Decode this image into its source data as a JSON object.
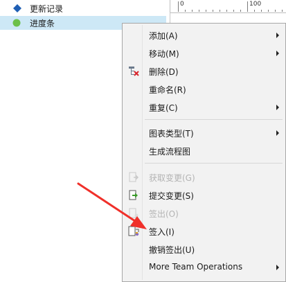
{
  "tree": {
    "items": [
      {
        "label": "更新记录",
        "icon": "diamond-node-icon",
        "color": "#1f5fb4"
      },
      {
        "label": "进度条",
        "icon": "green-dot-node-icon",
        "color": "#6cc04a",
        "selected": true
      }
    ]
  },
  "ruler": {
    "labels": [
      "0",
      "100"
    ]
  },
  "menu": {
    "items": [
      {
        "label": "添加(A)",
        "submenu": true,
        "enabled": true
      },
      {
        "label": "移动(M)",
        "submenu": true,
        "enabled": true
      },
      {
        "label": "删除(D)",
        "submenu": false,
        "enabled": true,
        "icon": "delete-node-icon"
      },
      {
        "label": "重命名(R)",
        "submenu": false,
        "enabled": true
      },
      {
        "label": "重复(C)",
        "submenu": true,
        "enabled": true
      },
      {
        "label": "图表类型(T)",
        "submenu": true,
        "enabled": true
      },
      {
        "label": "生成流程图",
        "submenu": false,
        "enabled": true
      },
      {
        "label": "获取变更(G)",
        "submenu": false,
        "enabled": false,
        "icon": "get-changes-icon"
      },
      {
        "label": "提交变更(S)",
        "submenu": false,
        "enabled": true,
        "icon": "commit-changes-icon"
      },
      {
        "label": "签出(O)",
        "submenu": false,
        "enabled": false,
        "icon": "checkout-icon"
      },
      {
        "label": "签入(I)",
        "submenu": false,
        "enabled": true,
        "icon": "checkin-icon"
      },
      {
        "label": "撤销签出(U)",
        "submenu": false,
        "enabled": true
      },
      {
        "label": "More Team Operations",
        "submenu": true,
        "enabled": true
      }
    ]
  },
  "annotation": {
    "arrow_color": "#f0302a"
  }
}
